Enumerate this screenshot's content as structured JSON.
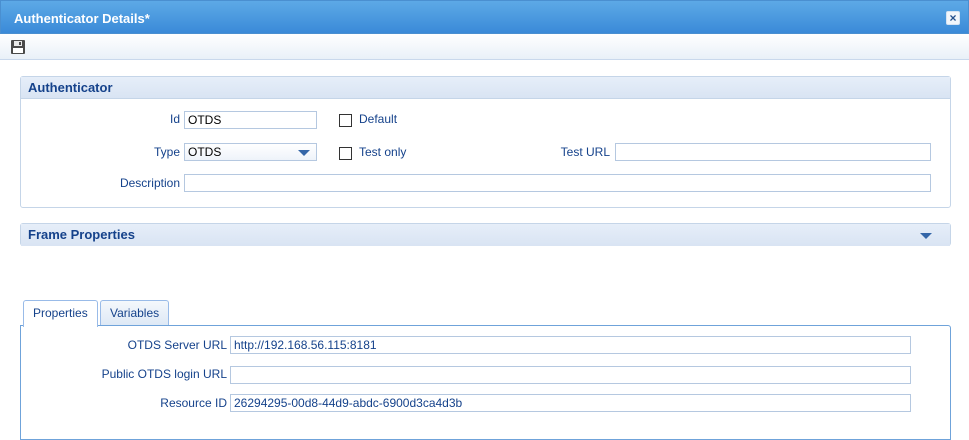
{
  "window": {
    "title": "Authenticator Details*"
  },
  "toolbar": {
    "save_icon": "save-icon"
  },
  "authenticator": {
    "section_title": "Authenticator",
    "id_label": "Id",
    "id_value": "OTDS",
    "default_label": "Default",
    "type_label": "Type",
    "type_value": "OTDS",
    "test_only_label": "Test only",
    "test_url_label": "Test URL",
    "test_url_value": "",
    "description_label": "Description",
    "description_value": ""
  },
  "frame_properties": {
    "section_title": "Frame Properties"
  },
  "tabs": [
    {
      "label": "Properties",
      "active": true
    },
    {
      "label": "Variables",
      "active": false
    }
  ],
  "properties": {
    "otds_server_url_label": "OTDS Server URL",
    "otds_server_url_value": "http://192.168.56.115:8181",
    "public_login_url_label": "Public OTDS login URL",
    "public_login_url_value": "",
    "resource_id_label": "Resource ID",
    "resource_id_value": "26294295-00d8-44d9-abdc-6900d3ca4d3b"
  },
  "colors": {
    "titlebar": "#3a8ad8",
    "label": "#15428b",
    "border": "#c5d5e8"
  }
}
